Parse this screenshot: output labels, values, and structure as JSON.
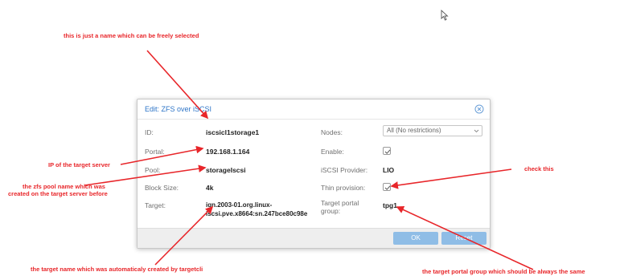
{
  "dialog": {
    "title": "Edit: ZFS over iSCSI",
    "fields": {
      "id_label": "ID:",
      "id_value": "iscsicl1storage1",
      "portal_label": "Portal:",
      "portal_value": "192.168.1.164",
      "pool_label": "Pool:",
      "pool_value": "storageIscsi",
      "blocksize_label": "Block Size:",
      "blocksize_value": "4k",
      "target_label": "Target:",
      "target_value_line1": "iqn.2003-01.org.linux-",
      "target_value_line2": "iscsi.pve.x8664:sn.247bce80c98e",
      "nodes_label": "Nodes:",
      "nodes_value": "All (No restrictions)",
      "enable_label": "Enable:",
      "enable_checked": true,
      "provider_label": "iSCSI Provider:",
      "provider_value": "LIO",
      "thin_label": "Thin provision:",
      "thin_checked": true,
      "tpg_label_line1": "Target portal",
      "tpg_label_line2": "group:",
      "tpg_value": "tpg1"
    },
    "buttons": {
      "ok_label": "OK",
      "reset_label": "Reset"
    }
  },
  "annotations": {
    "name_note": "this is just a name which can be freely selected",
    "ip_note": "IP of the target server",
    "pool_note_line1": "the zfs pool name which was",
    "pool_note_line2": "created on the target server before",
    "check_note": "check this",
    "target_note": "the target name which was automaticaly created by targetcli",
    "tpg_note": "the target portal group which should be always the same"
  },
  "colors": {
    "accent": "#2e75c8",
    "annotation": "#e8262a",
    "button": "#8fbde6"
  }
}
